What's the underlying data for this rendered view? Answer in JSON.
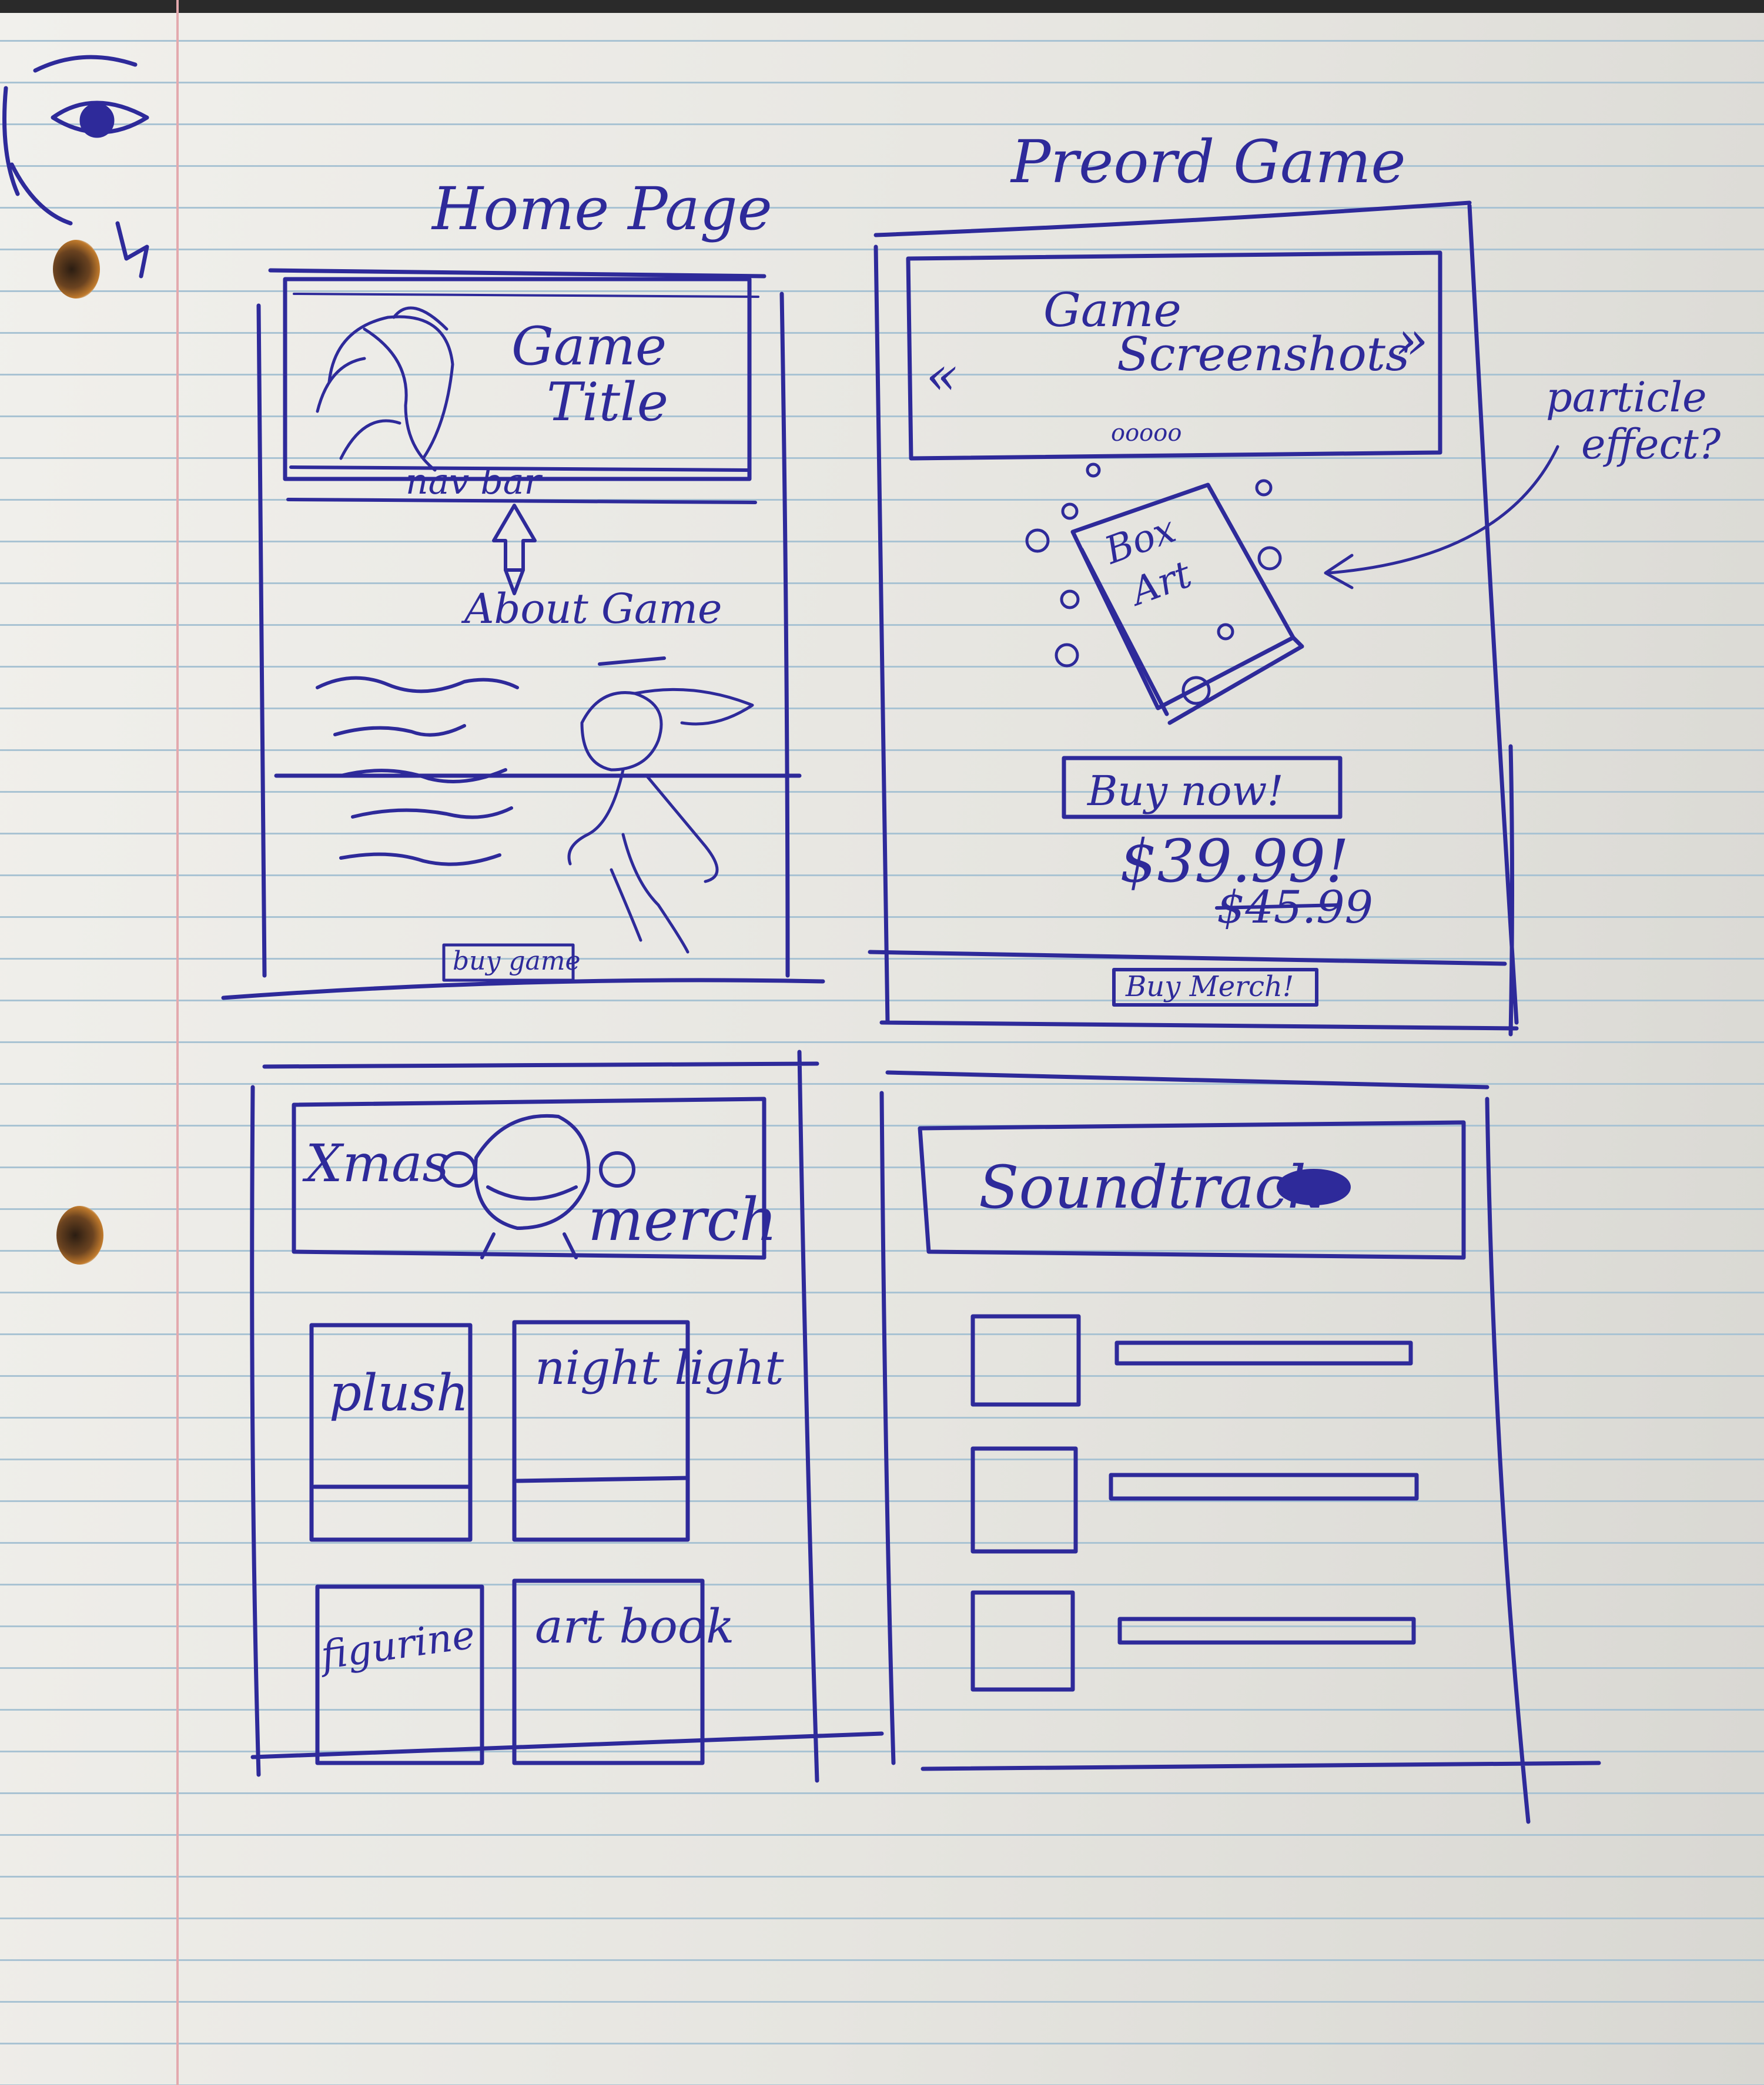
{
  "home": {
    "title": "Home Page",
    "game_title_line1": "Game",
    "game_title_line2": "Title",
    "nav_bar": "nav bar",
    "about": "About Game",
    "buy_button": "buy game"
  },
  "preorder": {
    "title": "Preord Game",
    "screenshots_line1": "Game",
    "screenshots_line2": "Screenshots",
    "prev_glyph": "«",
    "next_glyph": "»",
    "carousel_dots": "ooooo",
    "box_art_line1": "Box",
    "box_art_line2": "Art",
    "buy_now": "Buy now!",
    "price": "$39.99!",
    "old_price": "$45.99",
    "buy_merch": "Buy Merch!",
    "annotation_line1": "particle",
    "annotation_line2": "effect?"
  },
  "merch": {
    "banner_left": "Xmas",
    "banner_right": "merch",
    "items": [
      "plush",
      "night light",
      "figurine",
      "art book"
    ]
  },
  "soundtrack": {
    "title": "Soundtrack"
  },
  "colors": {
    "ink": "#2e2a9a",
    "paper": "#ecebe6",
    "rule_line": "#a9c3d3",
    "margin_line": "#e3a9ae"
  }
}
